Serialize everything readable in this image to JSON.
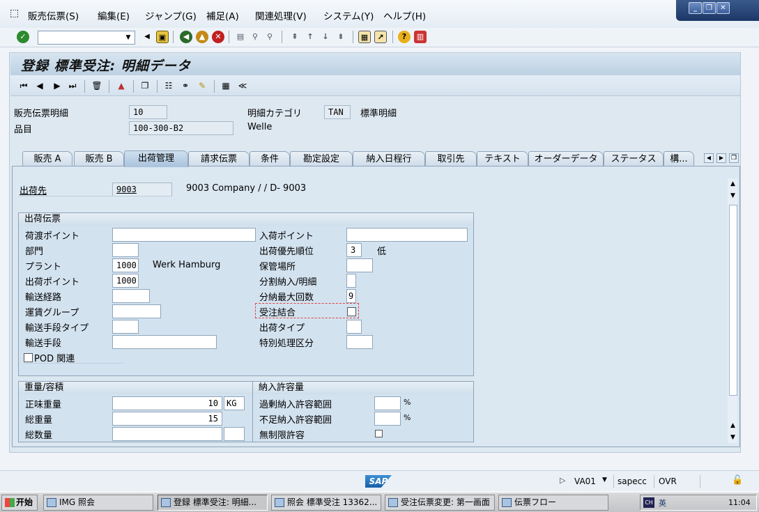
{
  "menu": {
    "items": [
      "販売伝票(S)",
      "編集(E)",
      "ジャンプ(G)",
      "補足(A)",
      "関連処理(V)",
      "システム(Y)",
      "ヘルプ(H)"
    ]
  },
  "window_buttons": {
    "minimize": "_",
    "restore": "❐",
    "close": "✕"
  },
  "toolbar1": {
    "command_value": ""
  },
  "screen": {
    "title": "登録 標準受注: 明細データ"
  },
  "header": {
    "item_label": "販売伝票明細",
    "item_value": "10",
    "category_label": "明細カテゴリ",
    "category_value": "TAN",
    "category_text": "標準明細",
    "material_label": "品目",
    "material_value": "100-300-B2",
    "material_text": "Welle"
  },
  "tabs": [
    "販売 A",
    "販売 B",
    "出荷管理",
    "請求伝票",
    "条件",
    "勘定設定",
    "納入日程行",
    "取引先",
    "テキスト",
    "オーダーデータ",
    "ステータス",
    "構..."
  ],
  "active_tab": "出荷管理",
  "shipto": {
    "label": "出荷先",
    "value": "9003",
    "text": "9003 Company / / D- 9003"
  },
  "shipping": {
    "title": "出荷伝票",
    "loading_point_label": "荷渡ポイント",
    "loading_point_value": "",
    "division_label": "部門",
    "division_value": "",
    "plant_label": "プラント",
    "plant_value": "1000",
    "plant_text": "Werk Hamburg",
    "shipping_point_label": "出荷ポイント",
    "shipping_point_value": "1000",
    "route_label": "輸送経路",
    "route_value": "",
    "freight_group_label": "運賃グループ",
    "freight_group_value": "",
    "transport_type_label": "輸送手段タイプ",
    "transport_type_value": "",
    "transport_label": "輸送手段",
    "transport_value": "",
    "pod_label": "POD 関連",
    "receiving_point_label": "入荷ポイント",
    "receiving_point_value": "",
    "priority_label": "出荷優先順位",
    "priority_value": "3",
    "priority_text": "低",
    "storage_label": "保管場所",
    "storage_value": "",
    "partial_label": "分割納入/明細",
    "partial_value": "",
    "max_deliveries_label": "分納最大回数",
    "max_deliveries_value": "9",
    "order_combination_label": "受注結合",
    "shipping_type_label": "出荷タイプ",
    "shipping_type_value": "",
    "special_label": "特別処理区分",
    "special_value": ""
  },
  "weights": {
    "title": "重量/容積",
    "net_label": "正味重量",
    "net_value": "10",
    "unit": "KG",
    "gross_label": "総重量",
    "gross_value": "15",
    "volume_label": "総数量",
    "volume_value": ""
  },
  "tolerance": {
    "title": "納入許容量",
    "over_label": "過剰納入許容範囲",
    "under_label": "不足納入許容範囲",
    "pct": "%",
    "unlimited_label": "無制限許容"
  },
  "status": {
    "logo": "SAP",
    "tcode": "VA01",
    "server": "sapecc",
    "mode": "OVR"
  },
  "taskbar": {
    "start": "开始",
    "tasks": [
      "IMG 照会",
      "登録 標準受注: 明細...",
      "照会 標準受注 13362...",
      "受注伝票変更: 第一画面",
      "伝票フロー"
    ],
    "clock": "11:04"
  }
}
